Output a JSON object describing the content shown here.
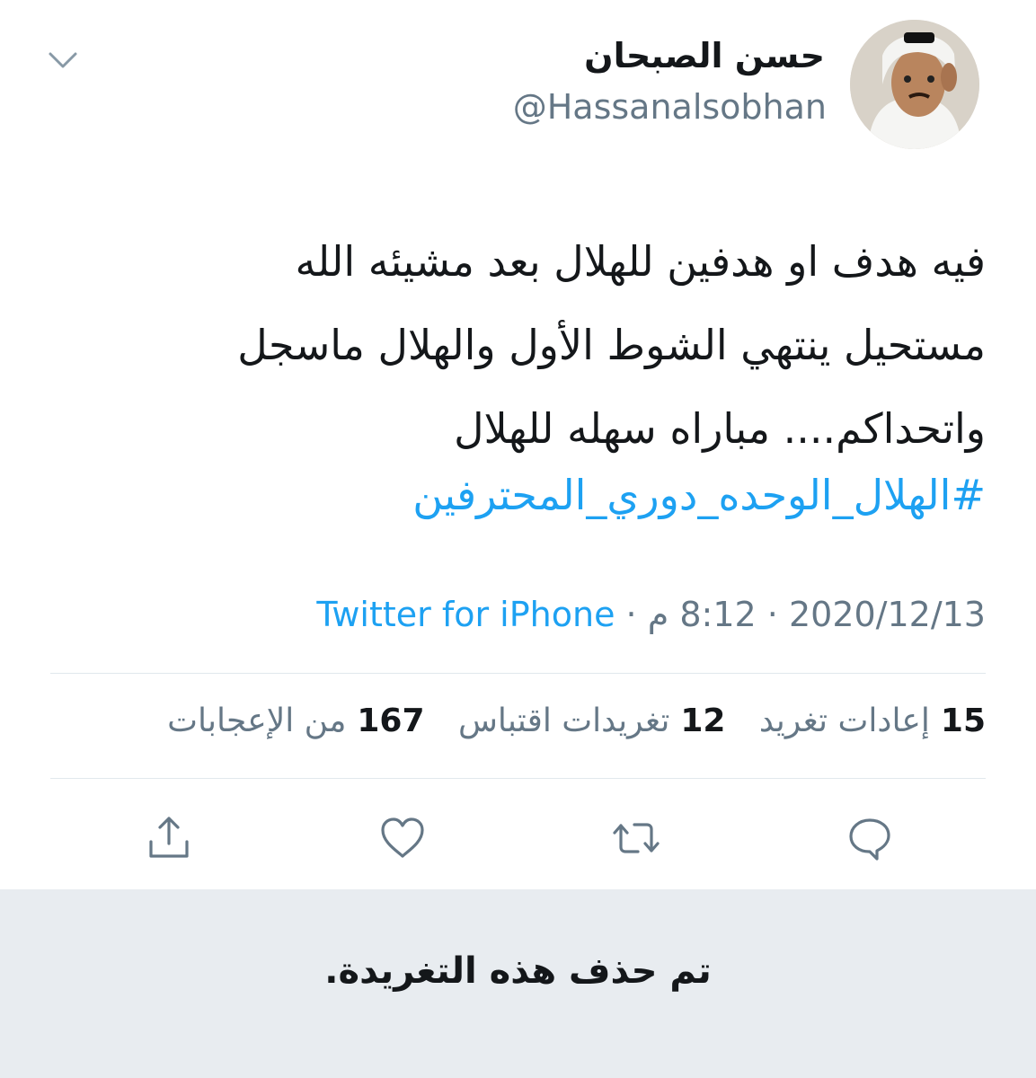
{
  "author": {
    "display_name": "حسن الصبحان",
    "handle": "@Hassanalsobhan"
  },
  "tweet": {
    "lines": [
      "فيه هدف او هدفين للهلال  بعد مشيئه الله",
      "مستحيل ينتهي الشوط الأول والهلال ماسجل",
      "واتحداكم.... مباراه سهله للهلال"
    ],
    "hashtag": "#الهلال_الوحده_دوري_المحترفين"
  },
  "meta": {
    "date": "2020/12/13",
    "separator": "·",
    "time": "8:12 م",
    "source": "Twitter for iPhone"
  },
  "stats": {
    "retweets_count": "15",
    "retweets_label": "إعادات تغريد",
    "quotes_count": "12",
    "quotes_label": "تغريدات اقتباس",
    "likes_count": "167",
    "likes_label": "من الإعجابات"
  },
  "actions": [
    "reply-icon",
    "retweet-icon",
    "like-icon",
    "share-icon"
  ],
  "deleted_notice": "تم حذف هذه التغريدة.",
  "colors": {
    "link": "#1da1f2",
    "secondary_text": "#657786",
    "panel_bg": "#e8ecf0"
  }
}
